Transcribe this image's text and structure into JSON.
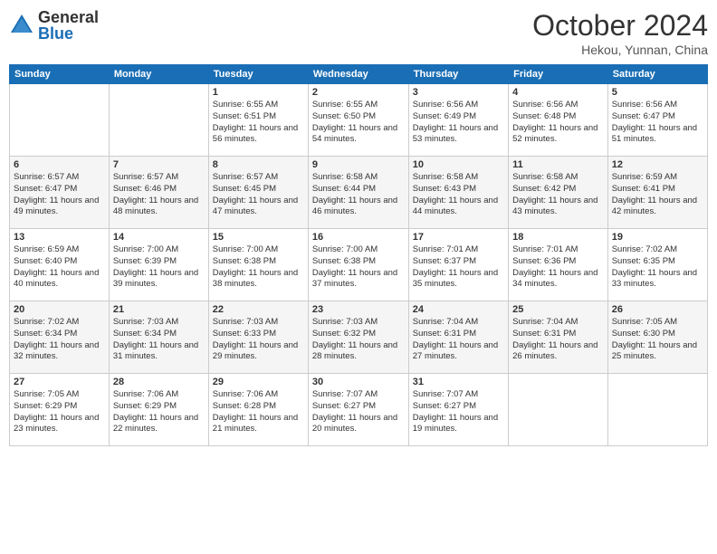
{
  "logo": {
    "general": "General",
    "blue": "Blue"
  },
  "header": {
    "title": "October 2024",
    "location": "Hekou, Yunnan, China"
  },
  "weekdays": [
    "Sunday",
    "Monday",
    "Tuesday",
    "Wednesday",
    "Thursday",
    "Friday",
    "Saturday"
  ],
  "weeks": [
    [
      null,
      null,
      {
        "day": 1,
        "sunrise": "6:55 AM",
        "sunset": "6:51 PM",
        "daylight": "11 hours and 56 minutes."
      },
      {
        "day": 2,
        "sunrise": "6:55 AM",
        "sunset": "6:50 PM",
        "daylight": "11 hours and 54 minutes."
      },
      {
        "day": 3,
        "sunrise": "6:56 AM",
        "sunset": "6:49 PM",
        "daylight": "11 hours and 53 minutes."
      },
      {
        "day": 4,
        "sunrise": "6:56 AM",
        "sunset": "6:48 PM",
        "daylight": "11 hours and 52 minutes."
      },
      {
        "day": 5,
        "sunrise": "6:56 AM",
        "sunset": "6:47 PM",
        "daylight": "11 hours and 51 minutes."
      }
    ],
    [
      {
        "day": 6,
        "sunrise": "6:57 AM",
        "sunset": "6:47 PM",
        "daylight": "11 hours and 49 minutes."
      },
      {
        "day": 7,
        "sunrise": "6:57 AM",
        "sunset": "6:46 PM",
        "daylight": "11 hours and 48 minutes."
      },
      {
        "day": 8,
        "sunrise": "6:57 AM",
        "sunset": "6:45 PM",
        "daylight": "11 hours and 47 minutes."
      },
      {
        "day": 9,
        "sunrise": "6:58 AM",
        "sunset": "6:44 PM",
        "daylight": "11 hours and 46 minutes."
      },
      {
        "day": 10,
        "sunrise": "6:58 AM",
        "sunset": "6:43 PM",
        "daylight": "11 hours and 44 minutes."
      },
      {
        "day": 11,
        "sunrise": "6:58 AM",
        "sunset": "6:42 PM",
        "daylight": "11 hours and 43 minutes."
      },
      {
        "day": 12,
        "sunrise": "6:59 AM",
        "sunset": "6:41 PM",
        "daylight": "11 hours and 42 minutes."
      }
    ],
    [
      {
        "day": 13,
        "sunrise": "6:59 AM",
        "sunset": "6:40 PM",
        "daylight": "11 hours and 40 minutes."
      },
      {
        "day": 14,
        "sunrise": "7:00 AM",
        "sunset": "6:39 PM",
        "daylight": "11 hours and 39 minutes."
      },
      {
        "day": 15,
        "sunrise": "7:00 AM",
        "sunset": "6:38 PM",
        "daylight": "11 hours and 38 minutes."
      },
      {
        "day": 16,
        "sunrise": "7:00 AM",
        "sunset": "6:38 PM",
        "daylight": "11 hours and 37 minutes."
      },
      {
        "day": 17,
        "sunrise": "7:01 AM",
        "sunset": "6:37 PM",
        "daylight": "11 hours and 35 minutes."
      },
      {
        "day": 18,
        "sunrise": "7:01 AM",
        "sunset": "6:36 PM",
        "daylight": "11 hours and 34 minutes."
      },
      {
        "day": 19,
        "sunrise": "7:02 AM",
        "sunset": "6:35 PM",
        "daylight": "11 hours and 33 minutes."
      }
    ],
    [
      {
        "day": 20,
        "sunrise": "7:02 AM",
        "sunset": "6:34 PM",
        "daylight": "11 hours and 32 minutes."
      },
      {
        "day": 21,
        "sunrise": "7:03 AM",
        "sunset": "6:34 PM",
        "daylight": "11 hours and 31 minutes."
      },
      {
        "day": 22,
        "sunrise": "7:03 AM",
        "sunset": "6:33 PM",
        "daylight": "11 hours and 29 minutes."
      },
      {
        "day": 23,
        "sunrise": "7:03 AM",
        "sunset": "6:32 PM",
        "daylight": "11 hours and 28 minutes."
      },
      {
        "day": 24,
        "sunrise": "7:04 AM",
        "sunset": "6:31 PM",
        "daylight": "11 hours and 27 minutes."
      },
      {
        "day": 25,
        "sunrise": "7:04 AM",
        "sunset": "6:31 PM",
        "daylight": "11 hours and 26 minutes."
      },
      {
        "day": 26,
        "sunrise": "7:05 AM",
        "sunset": "6:30 PM",
        "daylight": "11 hours and 25 minutes."
      }
    ],
    [
      {
        "day": 27,
        "sunrise": "7:05 AM",
        "sunset": "6:29 PM",
        "daylight": "11 hours and 23 minutes."
      },
      {
        "day": 28,
        "sunrise": "7:06 AM",
        "sunset": "6:29 PM",
        "daylight": "11 hours and 22 minutes."
      },
      {
        "day": 29,
        "sunrise": "7:06 AM",
        "sunset": "6:28 PM",
        "daylight": "11 hours and 21 minutes."
      },
      {
        "day": 30,
        "sunrise": "7:07 AM",
        "sunset": "6:27 PM",
        "daylight": "11 hours and 20 minutes."
      },
      {
        "day": 31,
        "sunrise": "7:07 AM",
        "sunset": "6:27 PM",
        "daylight": "11 hours and 19 minutes."
      },
      null,
      null
    ]
  ]
}
